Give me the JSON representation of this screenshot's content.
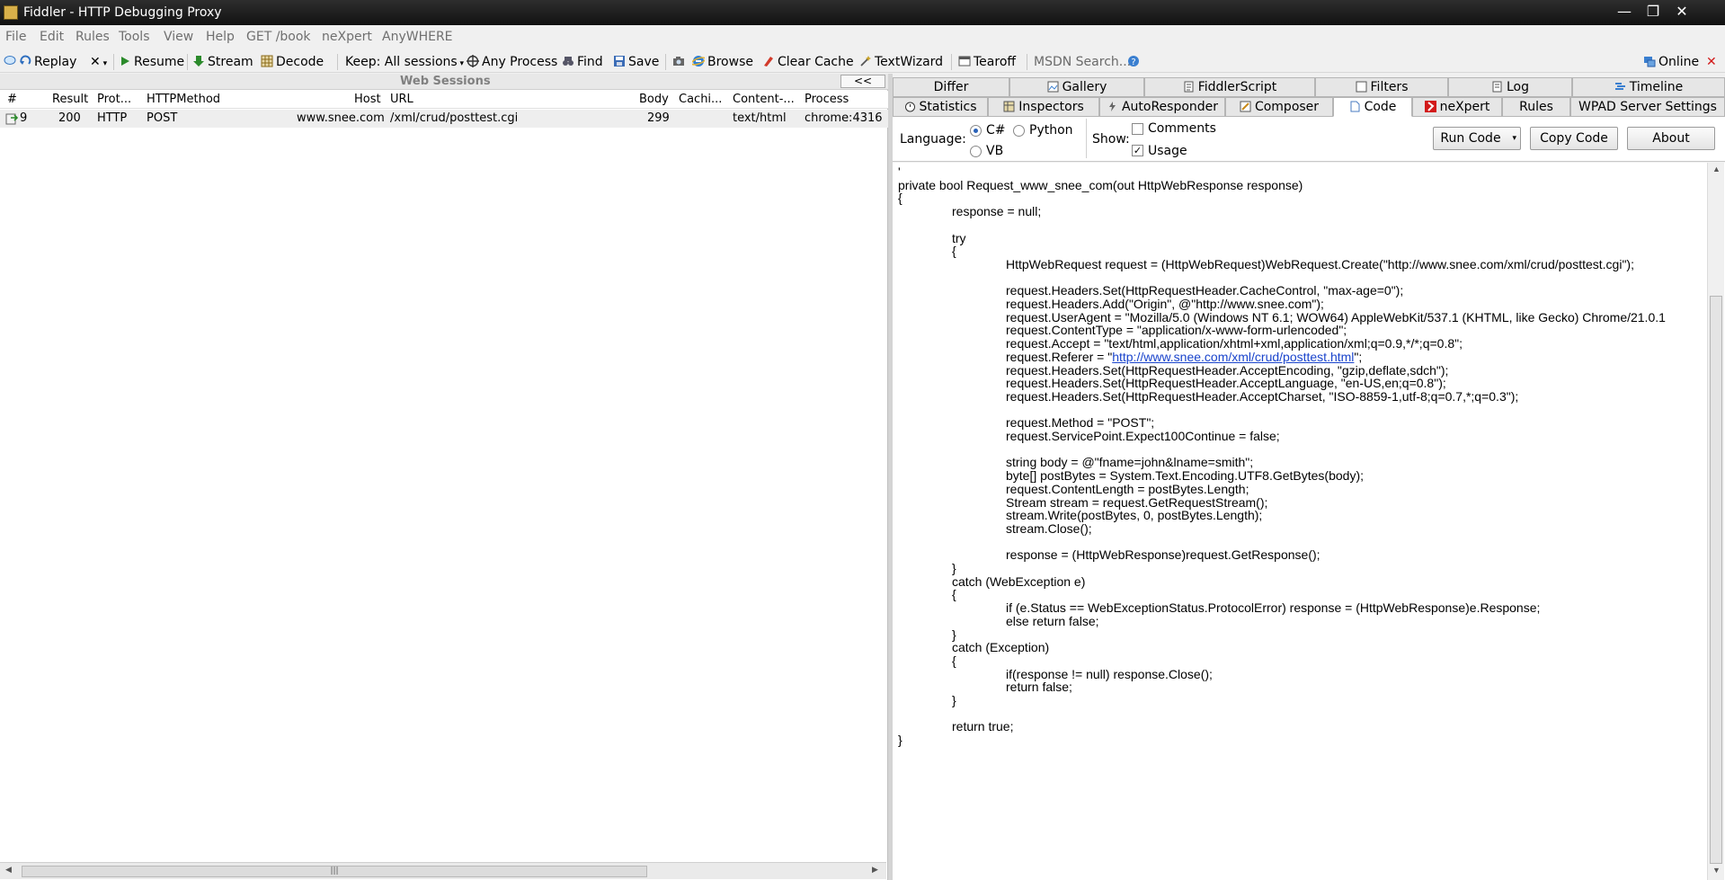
{
  "window": {
    "title": "Fiddler - HTTP Debugging Proxy",
    "controls": {
      "minimize": "—",
      "restore": "❐",
      "close": "✕"
    }
  },
  "menu": [
    "File",
    "Edit",
    "Rules",
    "Tools",
    "View",
    "Help",
    "GET /book",
    "neXpert",
    "AnyWHERE"
  ],
  "toolbar": {
    "replay": "Replay",
    "remove": "✕",
    "resume": "Resume",
    "stream": "Stream",
    "decode": "Decode",
    "keep": "Keep: All sessions",
    "process": "Any Process",
    "find": "Find",
    "save": "Save",
    "browse": "Browse",
    "clear_cache": "Clear Cache",
    "textwizard": "TextWizard",
    "tearoff": "Tearoff",
    "msdn_search": "MSDN Search...",
    "online": "Online",
    "close": "✕"
  },
  "sessions": {
    "title": "Web Sessions",
    "collapse": "<<",
    "columns": [
      "#",
      "Result",
      "Prot...",
      "HTTPMethod",
      "Host",
      "URL",
      "Body",
      "Cachi...",
      "Content-...",
      "Process"
    ],
    "rows": [
      {
        "id": "9",
        "result": "200",
        "protocol": "HTTP",
        "method": "POST",
        "host": "www.snee.com",
        "url": "/xml/crud/posttest.cgi",
        "body": "299",
        "caching": "",
        "content_type": "text/html",
        "process": "chrome:4316"
      }
    ],
    "scroll_grip": "|||"
  },
  "tabs_top": [
    "Differ",
    "Gallery",
    "FiddlerScript",
    "Filters",
    "Log",
    "Timeline"
  ],
  "tabs_bottom": [
    "Statistics",
    "Inspectors",
    "AutoResponder",
    "Composer",
    "Code",
    "neXpert",
    "Rules",
    "WPAD Server Settings"
  ],
  "active_tab": "Code",
  "code_options": {
    "language_label": "Language:",
    "languages": [
      "C#",
      "Python",
      "VB"
    ],
    "selected_language": "C#",
    "show_label": "Show:",
    "comments_label": "Comments",
    "comments_checked": false,
    "usage_label": "Usage",
    "usage_checked": true,
    "usage_mark": "✓",
    "run_code": "Run Code",
    "copy_code": "Copy Code",
    "about": "About"
  },
  "code_lines": [
    "'",
    "private bool Request_www_snee_com(out HttpWebResponse response)",
    "{",
    "\t\tresponse = null;",
    "",
    "\t\ttry",
    "\t\t{",
    "\t\t\t\tHttpWebRequest request = (HttpWebRequest)WebRequest.Create(\"http://www.snee.com/xml/crud/posttest.cgi\");",
    "",
    "\t\t\t\trequest.Headers.Set(HttpRequestHeader.CacheControl, \"max-age=0\");",
    "\t\t\t\trequest.Headers.Add(\"Origin\", @\"http://www.snee.com\");",
    "\t\t\t\trequest.UserAgent = \"Mozilla/5.0 (Windows NT 6.1; WOW64) AppleWebKit/537.1 (KHTML, like Gecko) Chrome/21.0.1",
    "\t\t\t\trequest.ContentType = \"application/x-www-form-urlencoded\";",
    "\t\t\t\trequest.Accept = \"text/html,application/xhtml+xml,application/xml;q=0.9,*/*;q=0.8\";",
    "REFERER",
    "\t\t\t\trequest.Headers.Set(HttpRequestHeader.AcceptEncoding, \"gzip,deflate,sdch\");",
    "\t\t\t\trequest.Headers.Set(HttpRequestHeader.AcceptLanguage, \"en-US,en;q=0.8\");",
    "\t\t\t\trequest.Headers.Set(HttpRequestHeader.AcceptCharset, \"ISO-8859-1,utf-8;q=0.7,*;q=0.3\");",
    "",
    "\t\t\t\trequest.Method = \"POST\";",
    "\t\t\t\trequest.ServicePoint.Expect100Continue = false;",
    "",
    "\t\t\t\tstring body = @\"fname=john&lname=smith\";",
    "\t\t\t\tbyte[] postBytes = System.Text.Encoding.UTF8.GetBytes(body);",
    "\t\t\t\trequest.ContentLength = postBytes.Length;",
    "\t\t\t\tStream stream = request.GetRequestStream();",
    "\t\t\t\tstream.Write(postBytes, 0, postBytes.Length);",
    "\t\t\t\tstream.Close();",
    "",
    "\t\t\t\tresponse = (HttpWebResponse)request.GetResponse();",
    "\t\t}",
    "\t\tcatch (WebException e)",
    "\t\t{",
    "\t\t\t\tif (e.Status == WebExceptionStatus.ProtocolError) response = (HttpWebResponse)e.Response;",
    "\t\t\t\telse return false;",
    "\t\t}",
    "\t\tcatch (Exception)",
    "\t\t{",
    "\t\t\t\tif(response != null) response.Close();",
    "\t\t\t\treturn false;",
    "\t\t}",
    "",
    "\t\treturn true;",
    "}"
  ],
  "referer_line": {
    "prefix": "request.Referer = \"",
    "link": "http://www.snee.com/xml/crud/posttest.html",
    "suffix": "\";"
  },
  "colors": {
    "titlebar": "#1b1b1b",
    "selected_row": "#eeeeee",
    "link": "#1a44cc",
    "close_red": "#d21a1a"
  }
}
